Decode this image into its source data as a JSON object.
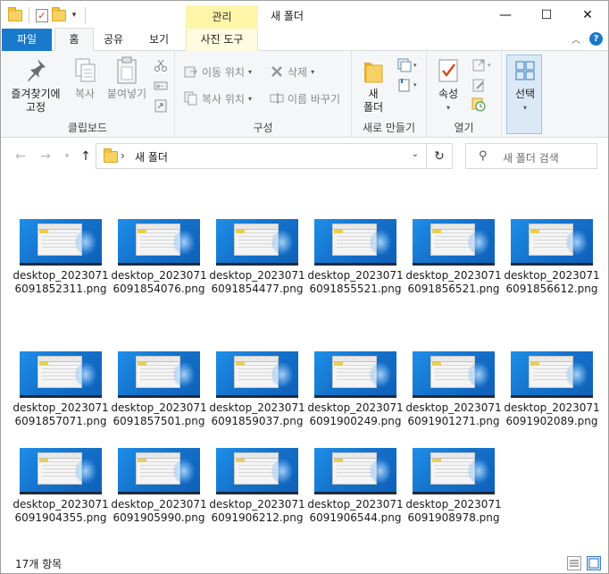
{
  "titlebar": {
    "title": "새 폴더",
    "context_tab_header": "관리",
    "window_controls": {
      "minimize": "—",
      "maximize": "☐",
      "close": "✕"
    }
  },
  "ribbon_tabs": [
    {
      "label": "파일"
    },
    {
      "label": "홈"
    },
    {
      "label": "공유"
    },
    {
      "label": "보기"
    },
    {
      "label": "사진 도구"
    }
  ],
  "ribbon": {
    "clipboard": {
      "label": "클립보드",
      "pin": "즐겨찾기에\n고정",
      "copy": "복사",
      "paste": "붙여넣기"
    },
    "organize": {
      "label": "구성",
      "move_to": "이동 위치",
      "copy_to": "복사 위치",
      "delete": "삭제",
      "rename": "이름 바꾸기"
    },
    "new": {
      "label": "새로 만들기",
      "new_folder": "새\n폴더"
    },
    "open": {
      "label": "열기",
      "properties": "속성"
    },
    "select": {
      "label": "선택"
    }
  },
  "address": {
    "path": "새 폴더",
    "separator": "›",
    "search_placeholder": "새 폴더 검색"
  },
  "files": [
    {
      "name": "desktop_20230716091852311.png"
    },
    {
      "name": "desktop_20230716091854076.png"
    },
    {
      "name": "desktop_20230716091854477.png"
    },
    {
      "name": "desktop_20230716091855521.png"
    },
    {
      "name": "desktop_20230716091856521.png"
    },
    {
      "name": "desktop_20230716091856612.png"
    },
    {
      "name": "desktop_20230716091857071.png"
    },
    {
      "name": "desktop_20230716091857501.png"
    },
    {
      "name": "desktop_20230716091859037.png"
    },
    {
      "name": "desktop_20230716091900249.png"
    },
    {
      "name": "desktop_20230716091901271.png"
    },
    {
      "name": "desktop_20230716091902089.png"
    },
    {
      "name": "desktop_20230716091904355.png"
    },
    {
      "name": "desktop_20230716091905990.png"
    },
    {
      "name": "desktop_20230716091906212.png"
    },
    {
      "name": "desktop_20230716091906544.png"
    },
    {
      "name": "desktop_20230716091908978.png"
    }
  ],
  "status": {
    "item_count": "17개 항목"
  },
  "colors": {
    "accent": "#1979ca",
    "context_tab": "#fef5a8",
    "selection": "#dbe9f7"
  }
}
